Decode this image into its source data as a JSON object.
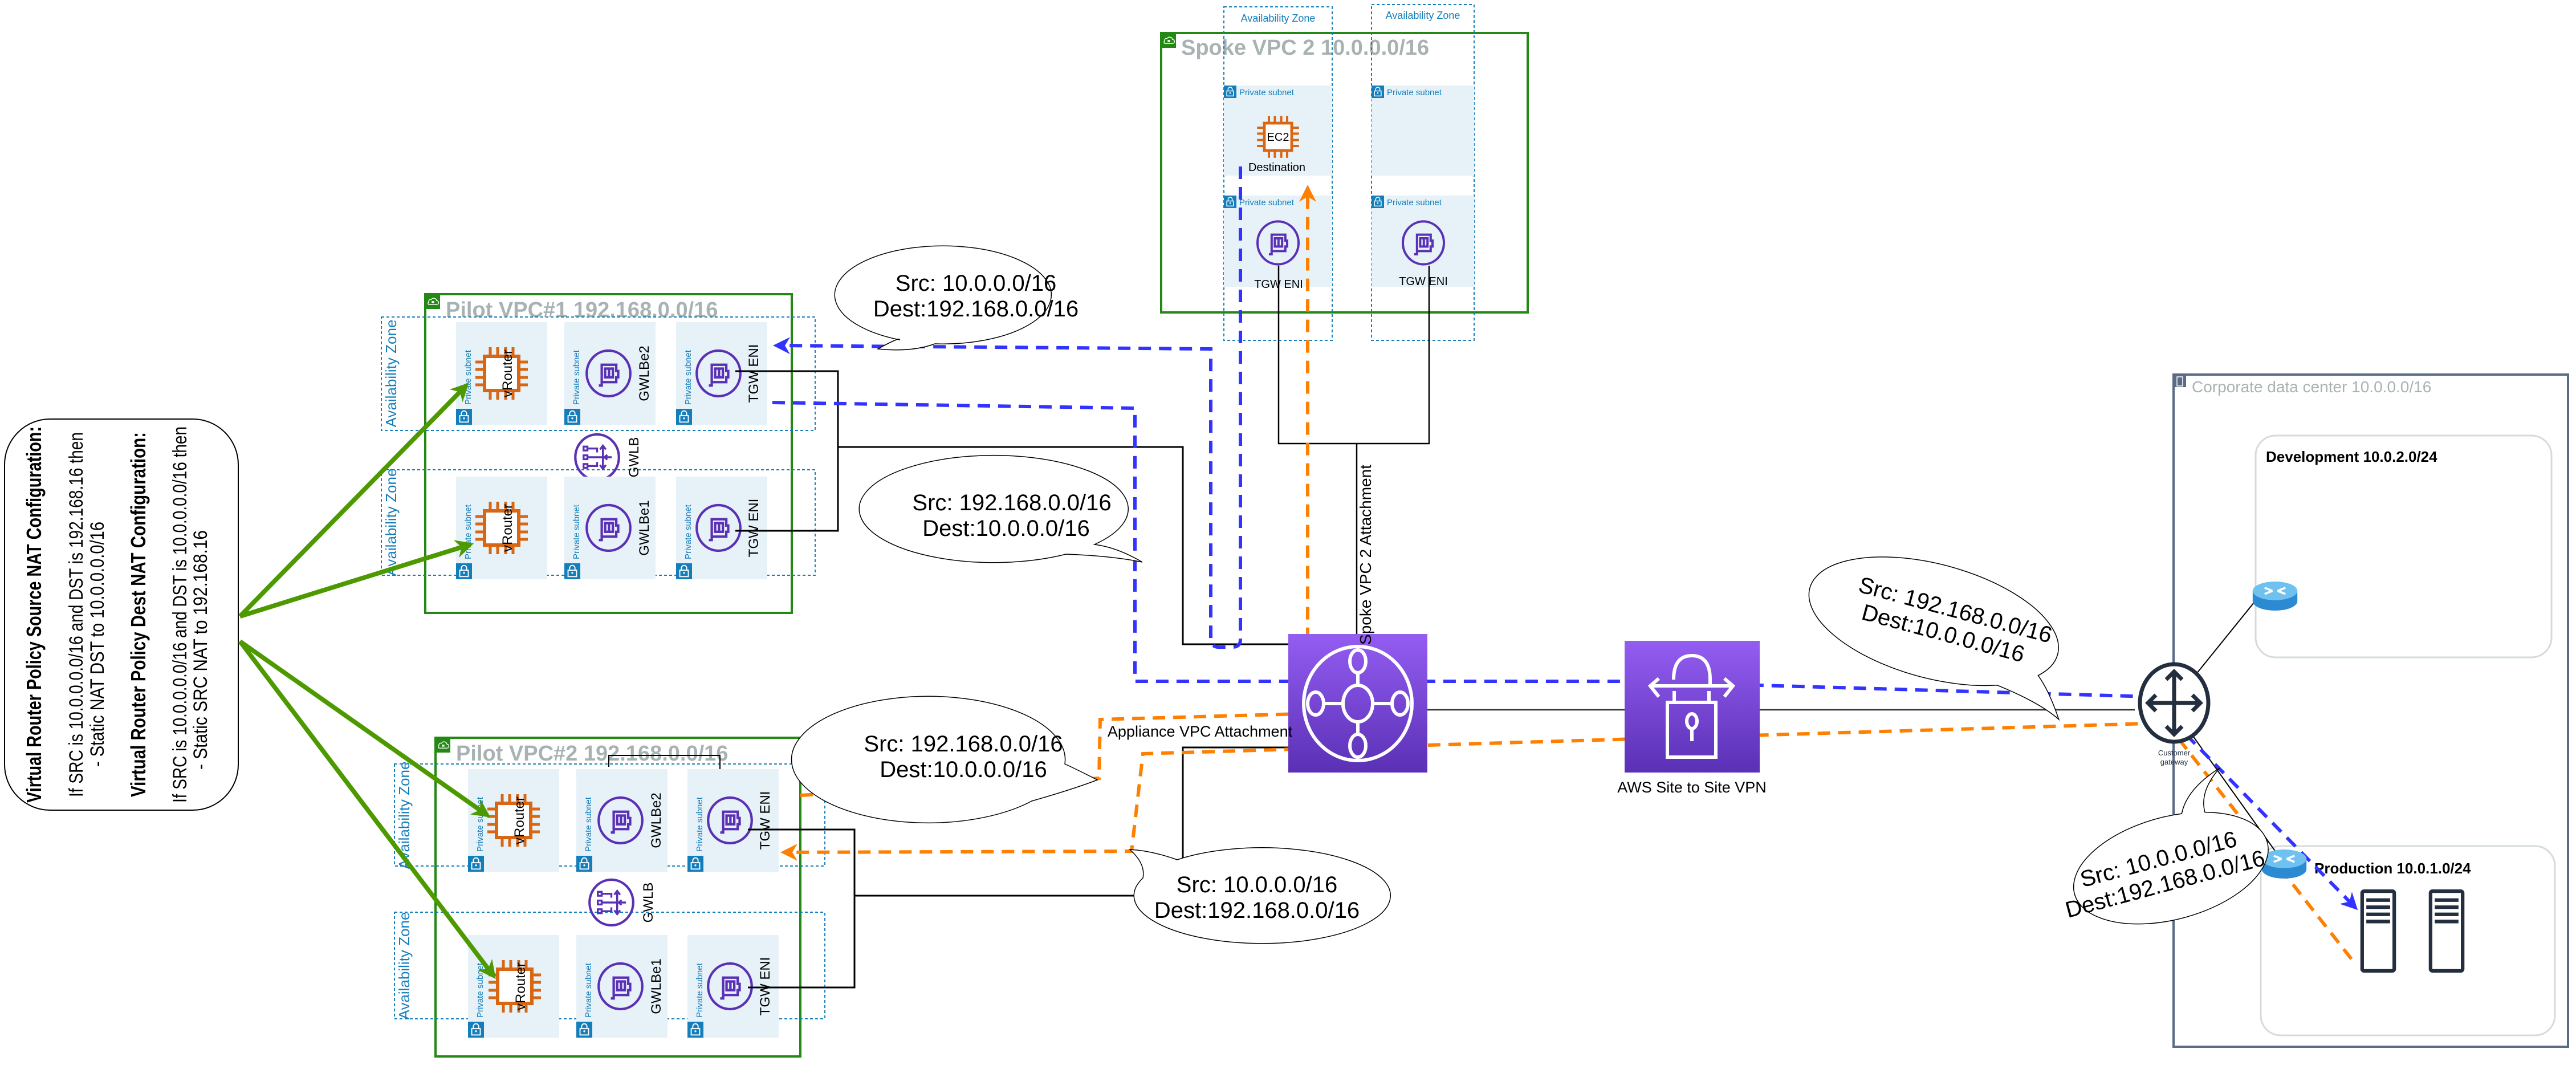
{
  "nat_box": {
    "source_title": "Virtual Router Policy Source NAT Configuration:",
    "source_rule": "If SRC is 10.0.0.0.0/16 and DST is 192.168.16 then",
    "source_action": "- Static NAT DST to 10.0.0.0.0/16",
    "dest_title": "Virtual Router Policy Dest NAT Configuration:",
    "dest_rule": "If SRC is 10.0.0.0.0/16 and DST is 10.0.0.0.0/16 then",
    "dest_action": "- Static SRC NAT to 192.168.16"
  },
  "pilot_vpc1": {
    "title": "Pilot VPC#1 192.168.0.0/16",
    "az_label": "Availability Zone",
    "subnet_label": "Private subnet",
    "vrouter": "vRouter",
    "gwlbe_top": "GWLBe2",
    "gwlbe_bottom": "GWLBe1",
    "tgw_eni": "TGW ENI",
    "gwlb": "GWLB"
  },
  "pilot_vpc2": {
    "title": "Pilot VPC#2 192.168.0.0/16",
    "az_label": "Availability Zone",
    "subnet_label": "Private subnet",
    "vrouter": "vRouter",
    "gwlbe_top": "GWLBe2",
    "gwlbe_bottom": "GWLBe1",
    "tgw_eni": "TGW ENI",
    "gwlb": "GWLB"
  },
  "spoke_vpc": {
    "title": "Spoke VPC 2 10.0.0.0/16",
    "az_label": "Availability Zone",
    "subnet_label": "Private subnet",
    "ec2": "EC2",
    "destination": "Destination",
    "tgw_eni": "TGW ENI"
  },
  "transit": {
    "spoke_attachment": "Spoke VPC 2 Attachment",
    "appliance_attachment": "Appliance VPC Attachment",
    "vpn_label": "AWS Site to Site VPN"
  },
  "callouts": [
    {
      "src": "Src: 10.0.0.0/16",
      "dest": "Dest:192.168.0.0/16"
    },
    {
      "src": "Src: 192.168.0.0/16",
      "dest": "Dest:10.0.0.0/16"
    },
    {
      "src": "Src: 192.168.0.0/16",
      "dest": "Dest:10.0.0.0/16"
    },
    {
      "src": "Src: 10.0.0.0/16",
      "dest": "Dest:192.168.0.0/16"
    },
    {
      "src": "Src: 192.168.0.0/16",
      "dest": "Dest:10.0.0.0/16"
    },
    {
      "src": "Src: 10.0.0.0/16",
      "dest": "Dest:192.168.0.0/16"
    }
  ],
  "corporate": {
    "title": "Corporate data center 10.0.0.0/16",
    "development": "Development 10.0.2.0/24",
    "production": "Production 10.0.1.0/24",
    "customer_gateway_line1": "Customer",
    "customer_gateway_line2": "gateway"
  },
  "colors": {
    "vpc_border": "#248814",
    "compute": "#D86613",
    "network": "#5A30B5",
    "subnet_fill": "#E6F1F8",
    "subnet_accent": "#147EBA",
    "flow_blue": "#3333FF",
    "flow_orange": "#FF8000",
    "nat_arrow": "#4D9900"
  }
}
